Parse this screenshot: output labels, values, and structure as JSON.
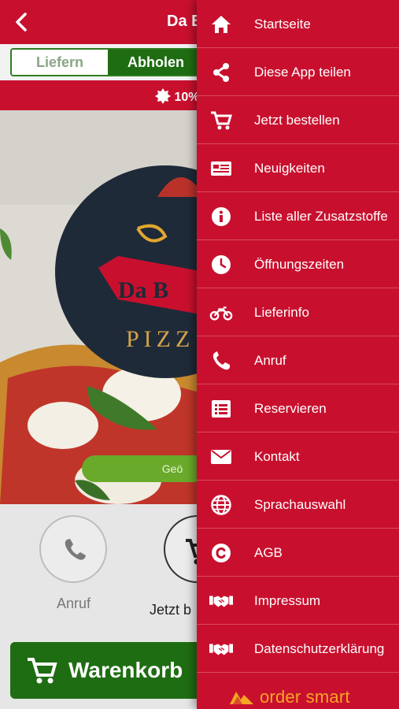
{
  "header": {
    "title": "Da B"
  },
  "order_toggle": {
    "deliver": "Liefern",
    "pickup": "Abholen"
  },
  "promo": {
    "text": "10%"
  },
  "hero": {
    "logo_text": "Da B",
    "logo_sub": "PIZZ",
    "status_button": "Geö"
  },
  "actions": {
    "call_label": "Anruf",
    "order_label": "Jetzt b"
  },
  "cart": {
    "label": "Warenkorb"
  },
  "menu": {
    "items": [
      {
        "label": "Startseite",
        "icon": "home-icon"
      },
      {
        "label": "Diese App teilen",
        "icon": "share-icon"
      },
      {
        "label": "Jetzt bestellen",
        "icon": "cart-icon"
      },
      {
        "label": "Neuigkeiten",
        "icon": "news-icon"
      },
      {
        "label": "Liste aller Zusatzstoffe",
        "icon": "info-icon"
      },
      {
        "label": "Öffnungszeiten",
        "icon": "clock-icon"
      },
      {
        "label": "Lieferinfo",
        "icon": "motorcycle-icon"
      },
      {
        "label": "Anruf",
        "icon": "phone-icon"
      },
      {
        "label": "Reservieren",
        "icon": "list-icon"
      },
      {
        "label": "Kontakt",
        "icon": "envelope-icon"
      },
      {
        "label": "Sprachauswahl",
        "icon": "globe-icon"
      },
      {
        "label": "AGB",
        "icon": "copyright-icon"
      },
      {
        "label": "Impressum",
        "icon": "handshake-icon"
      },
      {
        "label": "Datenschutzerklärung",
        "icon": "handshake-icon"
      }
    ]
  },
  "brand": {
    "text": "order smart"
  },
  "colors": {
    "primary_red": "#c8102e",
    "green": "#1f6d12",
    "brand_orange": "#f5a623"
  }
}
